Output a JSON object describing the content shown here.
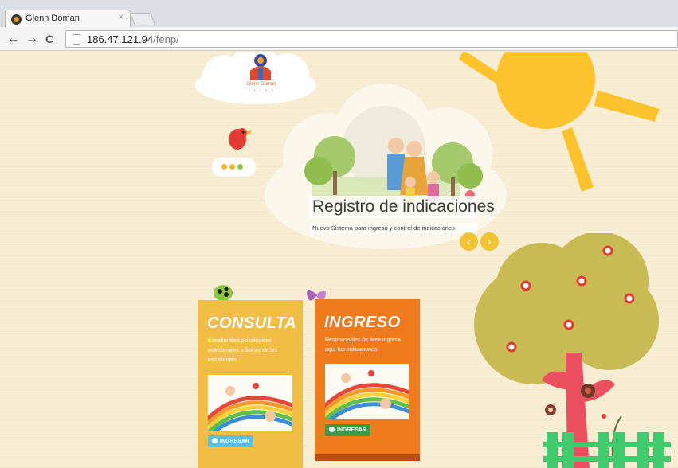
{
  "browser": {
    "tab_title": "Glenn Doman",
    "tab_close": "×",
    "url_host": "186.47.121.94",
    "url_path": "/fenp/",
    "back": "←",
    "forward": "→",
    "reload": "C"
  },
  "header": {
    "logo_text": "Glenn Doman",
    "logo_sub": "• • • • •"
  },
  "slider": {
    "title": "Registro de indicaciones",
    "subtitle": "Nuevo Sistema para ingreso y control de indicaciones",
    "prev": "‹",
    "next": "›"
  },
  "cards": {
    "consulta": {
      "title": "CONSULTA",
      "text": "Estudiantiles psicologicas nutricionales y fisicas de los estudiantes",
      "button": "INGRESAR"
    },
    "ingreso": {
      "title": "INGRESO",
      "text": "Responsables de área,ingresa aquí tus indicaciones",
      "button": "INGRESAR"
    }
  },
  "colors": {
    "background": "#f7edd2",
    "consulta": "#f2bd45",
    "ingreso": "#f07b1d",
    "sun": "#fcc32c",
    "tree_canopy": "#c9bb53",
    "tree_trunk": "#ec4f5f",
    "fence": "#3fcb6d",
    "btn_info": "#5bc0de",
    "btn_success": "#3a9a46"
  }
}
